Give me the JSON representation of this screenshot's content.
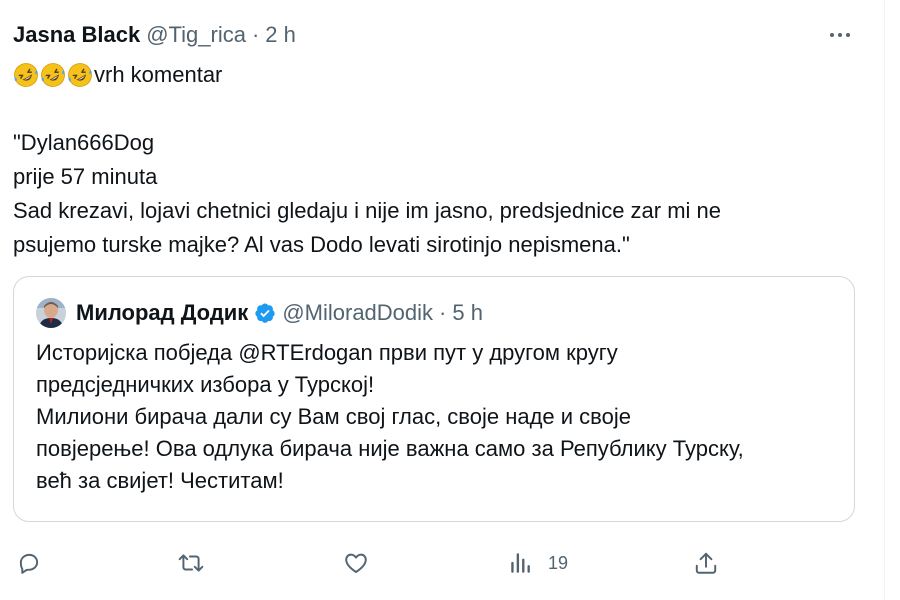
{
  "tweet": {
    "author_name": "Jasna Black",
    "author_handle": "@Tig_rica",
    "separator": "·",
    "time": "2 h",
    "emoji_count": 3,
    "first_line_text": "vrh komentar",
    "quoted_lines": [
      "\"Dylan666Dog",
      "prije 57 minuta",
      "Sad krezavi, lojavi chetnici gledaju i nije im jasno, predsjednice zar mi ne",
      "psujemo turske majke? Al vas Dodo levati sirotinjo nepismena.\""
    ]
  },
  "quote": {
    "author_name": "Милорад Додик",
    "author_handle": "@MiloradDodik",
    "separator": "·",
    "time": "5 h",
    "lines": [
      "Историјска побједа  @RTErdogan први пут у другом кругу",
      "предсједничких избора у Турској!",
      "Милиони бирача дали су Вам свој глас, своје наде и своје",
      "повјерење! Ова одлука бирача није важна само за Републику Турску,",
      "већ за свијет! Честитам!"
    ]
  },
  "actions": {
    "reply_icon": "reply-icon",
    "retweet_icon": "retweet-icon",
    "like_icon": "like-icon",
    "views_icon": "views-icon",
    "views_count": "19",
    "share_icon": "share-icon"
  },
  "colors": {
    "text": "#0f1419",
    "muted": "#536471",
    "border": "#cfd9de",
    "verified_badge": "#1d9bf0",
    "emoji": "#f5c21b"
  }
}
